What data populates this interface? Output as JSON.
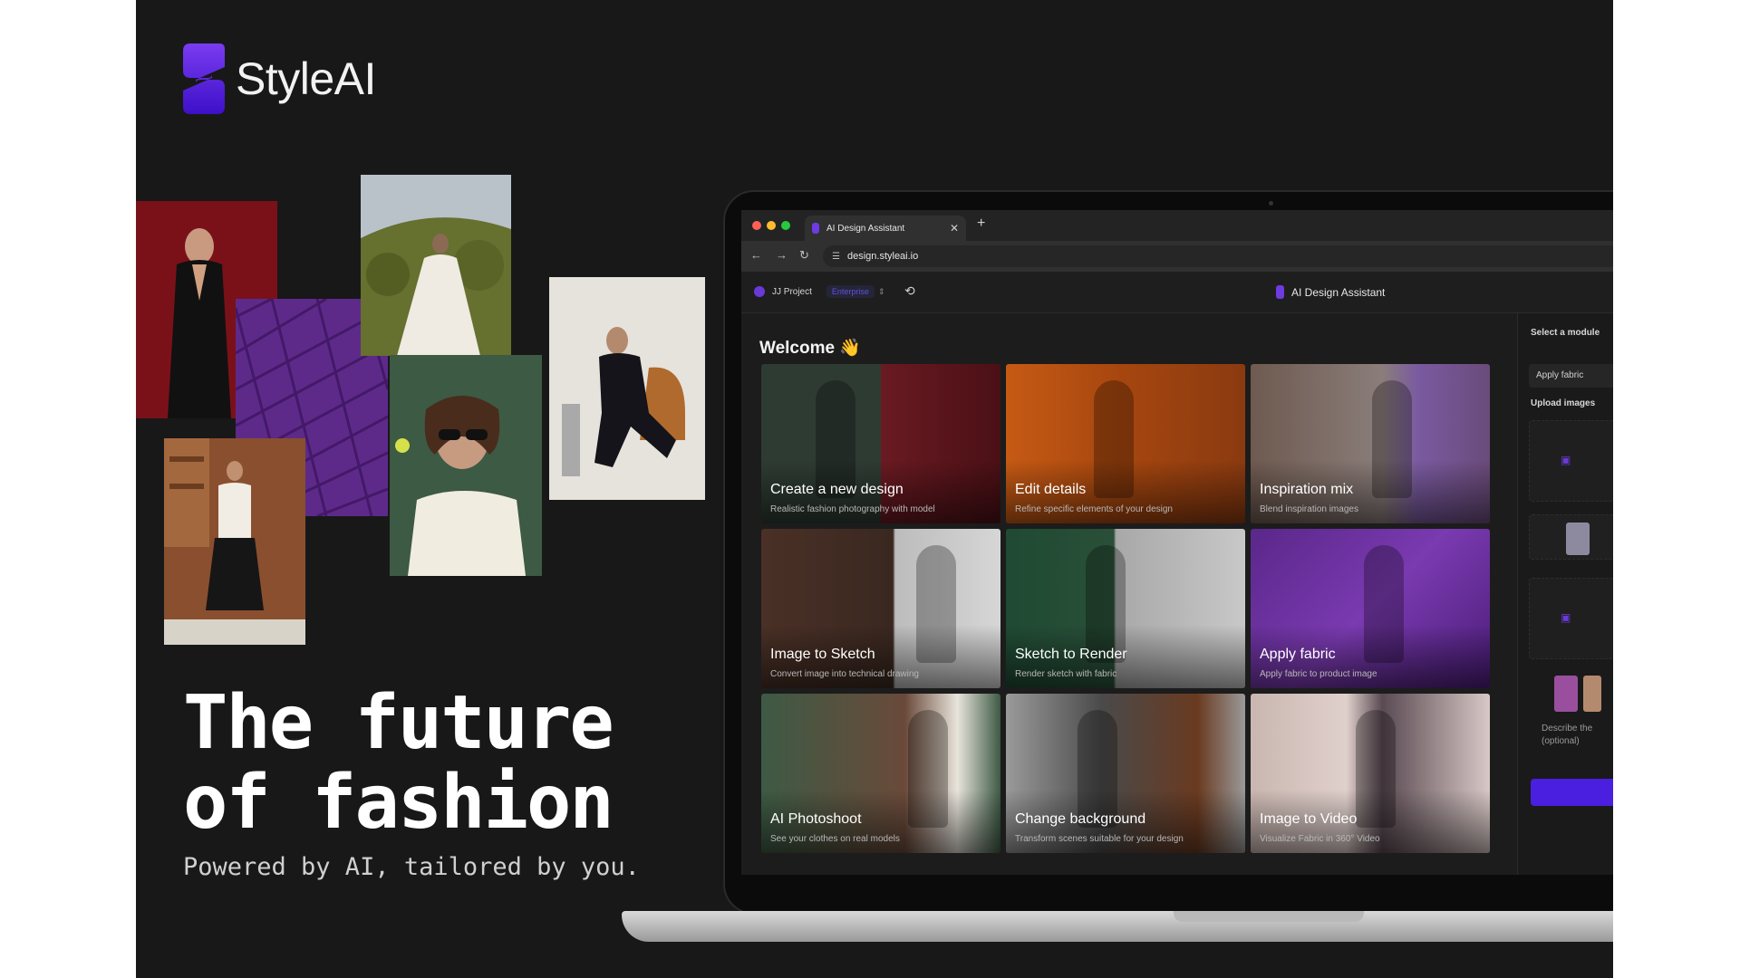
{
  "brand": {
    "name": "StyleAI",
    "accent": "#5b21e6"
  },
  "hero": {
    "headline_line1": "The future",
    "headline_line2": "of fashion",
    "tagline": "Powered by AI, tailored by you."
  },
  "browser": {
    "tab_title": "AI Design Assistant",
    "url": "design.styleai.io"
  },
  "app": {
    "project_name": "JJ Project",
    "plan": "Enterprise",
    "title": "AI Design Assistant",
    "welcome": "Welcome 👋"
  },
  "modules": [
    {
      "title": "Create a new design",
      "subtitle": "Realistic fashion photography with model"
    },
    {
      "title": "Edit details",
      "subtitle": "Refine specific elements of your design"
    },
    {
      "title": "Inspiration mix",
      "subtitle": "Blend inspiration images"
    },
    {
      "title": "Image to Sketch",
      "subtitle": "Convert image into technical drawing"
    },
    {
      "title": "Sketch to Render",
      "subtitle": "Render sketch with fabric"
    },
    {
      "title": "Apply fabric",
      "subtitle": "Apply fabric to product image"
    },
    {
      "title": "AI Photoshoot",
      "subtitle": "See your clothes on real models"
    },
    {
      "title": "Change background",
      "subtitle": "Transform scenes suitable for your design"
    },
    {
      "title": "Image to Video",
      "subtitle": "Visualize Fabric in 360° Video"
    }
  ],
  "right_panel": {
    "select_label": "Select a module",
    "select_value": "Apply fabric",
    "upload_label": "Upload images",
    "describe_placeholder": "Describe the (optional)"
  }
}
